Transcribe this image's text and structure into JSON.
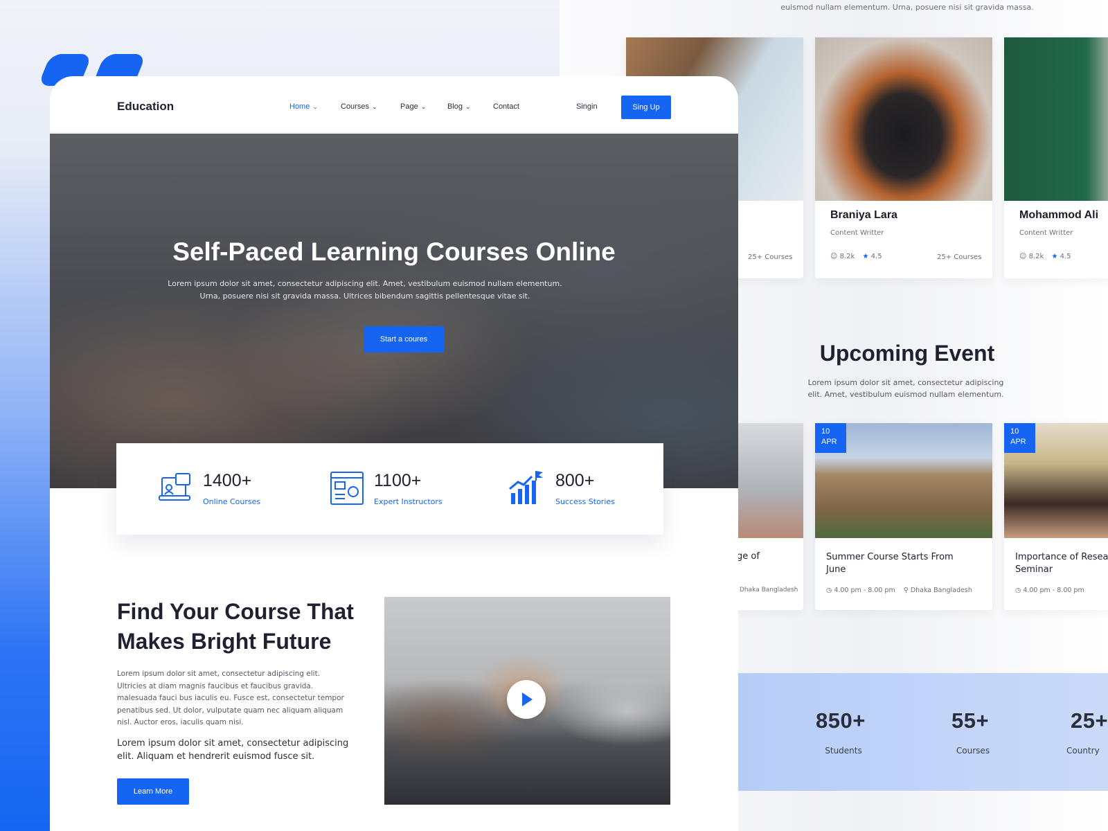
{
  "brand": {
    "name": "Education",
    "accent": "#1565f2"
  },
  "nav": {
    "items": [
      {
        "label": "Home",
        "chevron": true,
        "active": true
      },
      {
        "label": "Courses",
        "chevron": true
      },
      {
        "label": "Page",
        "chevron": true
      },
      {
        "label": "Blog",
        "chevron": true
      },
      {
        "label": "Contact",
        "chevron": false
      }
    ],
    "signin": "Singin",
    "signup": "Sing Up"
  },
  "hero": {
    "title": "Self-Paced Learning Courses Online",
    "subtitle": "Lorem ipsum dolor sit amet, consectetur adipiscing elit. Amet, vestibulum euismod nullam elementum. Urna, posuere nisi sit gravida massa. Ultrices bibendum sagittis pellentesque vitae sit.",
    "cta": "Start a coures"
  },
  "stats": [
    {
      "icon": "online-course-icon",
      "value": "1400+",
      "label": "Online Courses"
    },
    {
      "icon": "instructor-icon",
      "value": "1100+",
      "label": "Expert Instructors"
    },
    {
      "icon": "growth-chart-icon",
      "value": "800+",
      "label": "Success Stories"
    }
  ],
  "find": {
    "title": "Find Your Course That Makes Bright Future",
    "para1": "Lorem ipsum dolor sit amet, consectetur adipiscing elit. Ultricies at diam magnis faucibus et faucibus gravida. malesuada fauci bus iaculis eu. Fusce est, consectetur tempor penatibus sed. Ut dolor, vulputate quam nec aliquam aliquam nisl. Auctor eros, iaculis quam nisi.",
    "para2": "Lorem ipsum dolor sit amet, consectetur adipiscing elit. Aliquam et hendrerit euismod fusce sit.",
    "button": "Learn More"
  },
  "right": {
    "top_text": "euismod nullam elementum. Urna, posuere nisi sit gravida massa.",
    "instructors": [
      {
        "name": "",
        "role": "",
        "students": "",
        "rating": "",
        "courses": "25+ Courses"
      },
      {
        "name": "Braniya Lara",
        "role": "Content Writter",
        "students": "8.2k",
        "rating": "4.5",
        "courses": "25+ Courses"
      },
      {
        "name": "Mohammod Ali",
        "role": "Content Writter",
        "students": "8.2k",
        "rating": "4.5",
        "courses": ""
      }
    ],
    "events_title": "Upcoming Event",
    "events_sub": "Lorem ipsum dolor sit amet, consectetur adipiscing elit. Amet, vestibulum euismod nullam elementum.",
    "events": [
      {
        "day": "",
        "month": "",
        "title": "ge of",
        "time": "",
        "place": "Dhaka Bangladesh"
      },
      {
        "day": "10",
        "month": "APR",
        "title": "Summer Course Starts From June",
        "time": "4.00 pm - 8.00 pm",
        "place": "Dhaka Bangladesh"
      },
      {
        "day": "10",
        "month": "APR",
        "title": "Importance of Research Seminar",
        "time": "4.00 pm - 8.00 pm",
        "place": ""
      }
    ],
    "totals": [
      {
        "value": "850+",
        "label": "Students"
      },
      {
        "value": "55+",
        "label": "Courses"
      },
      {
        "value": "25+",
        "label": "Country"
      }
    ]
  }
}
